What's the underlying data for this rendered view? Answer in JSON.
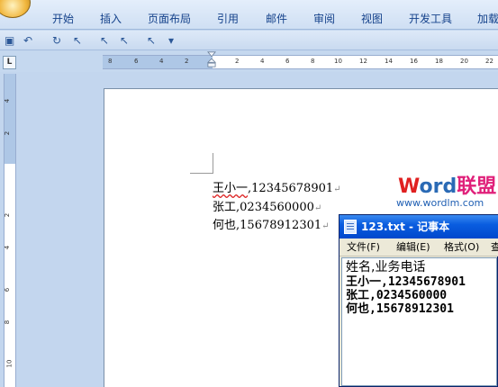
{
  "ribbon": {
    "tabs": [
      "开始",
      "插入",
      "页面布局",
      "引用",
      "邮件",
      "审阅",
      "视图",
      "开发工具",
      "加载"
    ]
  },
  "qat": {
    "icons": [
      "save-icon",
      "undo-icon",
      "redo-icon",
      "pointer-icon",
      "pointer-icon",
      "pointer-icon",
      "pointer-icon",
      "customize-icon"
    ],
    "glyphs": [
      "▣",
      "↶",
      "↻",
      "↖",
      "↖",
      "↖",
      "↖",
      "▾"
    ]
  },
  "ruler": {
    "corner_label": "L",
    "h_ticks": [
      "8",
      "6",
      "4",
      "2",
      "2",
      "4",
      "6",
      "8",
      "10",
      "12",
      "14",
      "16",
      "18",
      "20",
      "22"
    ],
    "v_ticks": [
      "4",
      "2",
      "2",
      "4",
      "6",
      "8",
      "10"
    ]
  },
  "document": {
    "lines": [
      {
        "name": "王小一",
        "rest": ",12345678901"
      },
      {
        "name": "张工",
        "rest": ",0234560000"
      },
      {
        "name": "何也",
        "rest": ",15678912301"
      }
    ],
    "pilcrow": "↵"
  },
  "logo": {
    "w": "W",
    "ord": "ord",
    "cn": "联盟",
    "url": "www.wordlm.com"
  },
  "notepad": {
    "title": "123.txt - 记事本",
    "menu": [
      "文件(F)",
      "编辑(E)",
      "格式(O)",
      "查"
    ],
    "lines": [
      "姓名,业务电话",
      "王小一,12345678901",
      "张工,0234560000",
      "何也,15678912301"
    ]
  }
}
